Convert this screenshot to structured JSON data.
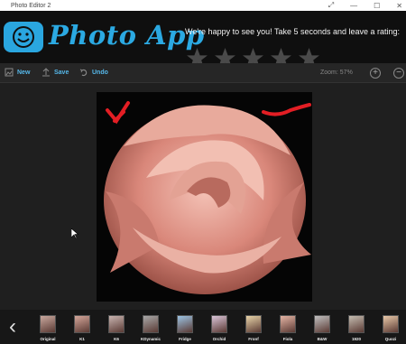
{
  "window": {
    "title": "Photo Editor 2",
    "controls": [
      "⤢",
      "—",
      "☐",
      "✕"
    ]
  },
  "banner": {
    "app_name": "Photo App",
    "rating_prompt": "We're happy to see you! Take 5 seconds and leave a rating:",
    "stars": 5,
    "brand_color": "#2ba9e2"
  },
  "toolbar": {
    "new_label": "New",
    "save_label": "Save",
    "undo_label": "Undo",
    "zoom_label": "Zoom: 57%",
    "zoom_in": "+",
    "zoom_out": "−"
  },
  "filmstrip": {
    "back": "‹",
    "filters": [
      {
        "label": "Original",
        "color": "#c9a89e"
      },
      {
        "label": "K1",
        "color": "#d4a69a"
      },
      {
        "label": "K6",
        "color": "#c8b4b0"
      },
      {
        "label": "KDynamic",
        "color": "#a8a8a8"
      },
      {
        "label": "Fridge",
        "color": "#9cc4e4"
      },
      {
        "label": "Orchid",
        "color": "#d9c4d8"
      },
      {
        "label": "Fronf",
        "color": "#e8d4a8"
      },
      {
        "label": "Fiola",
        "color": "#e4b4a4"
      },
      {
        "label": "B&W",
        "color": "#c0c0c0"
      },
      {
        "label": "1920",
        "color": "#c4bcb0"
      },
      {
        "label": "Quozi",
        "color": "#e8c8a8"
      }
    ]
  }
}
